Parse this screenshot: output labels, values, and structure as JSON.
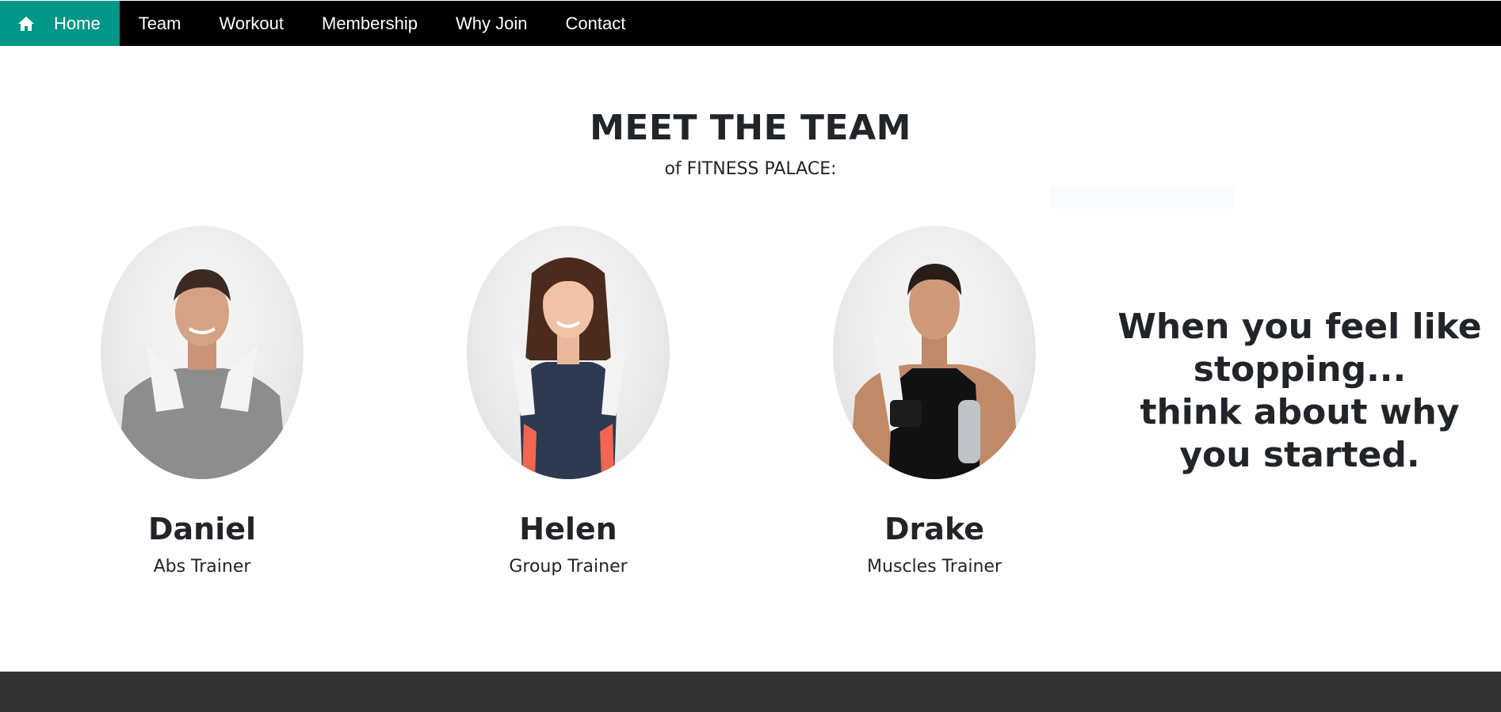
{
  "nav": {
    "home_icon": "home-icon",
    "items": [
      {
        "label": "Home",
        "active": true
      },
      {
        "label": "Team"
      },
      {
        "label": "Workout"
      },
      {
        "label": "Membership"
      },
      {
        "label": "Why Join"
      },
      {
        "label": "Contact"
      }
    ],
    "colors": {
      "bar": "#000000",
      "active": "#009688",
      "text": "#ffffff"
    }
  },
  "team": {
    "title": "MEET THE TEAM",
    "subtitle": "of FITNESS PALACE:",
    "members": [
      {
        "name": "Daniel",
        "role": "Abs Trainer"
      },
      {
        "name": "Helen",
        "role": "Group Trainer"
      },
      {
        "name": "Drake",
        "role": "Muscles Trainer"
      }
    ]
  },
  "quote": {
    "line1": "When you feel like stopping...",
    "line2": "think about why you started."
  },
  "footer": {
    "color": "#333333"
  }
}
